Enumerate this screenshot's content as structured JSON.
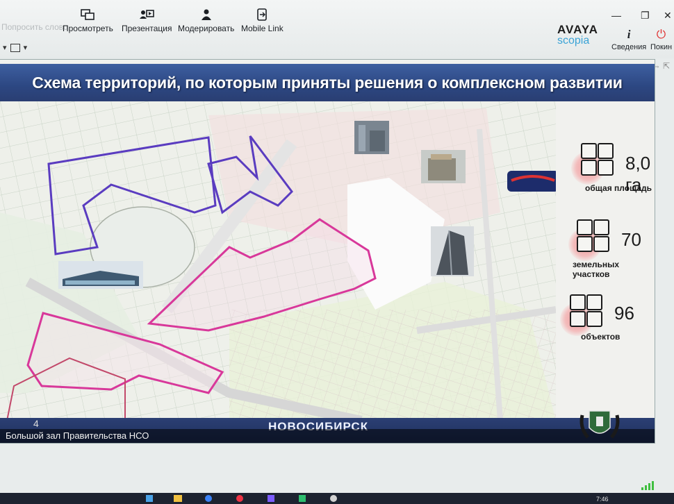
{
  "toolbar": {
    "ghost_label": "Попросить слово",
    "items": [
      {
        "label": "Просмотреть",
        "icon": "view-icon"
      },
      {
        "label": "Презентация",
        "icon": "presentation-icon"
      },
      {
        "label": "Модерировать",
        "icon": "moderate-icon"
      },
      {
        "label": "Mobile Link",
        "icon": "mobile-link-icon"
      }
    ],
    "brand_line1": "AVAYA",
    "brand_line2": "scopia",
    "info_label": "Сведения",
    "leave_label": "Покин"
  },
  "slide": {
    "title": "Схема территорий, по которым приняты решения о комплексном развитии",
    "stats": [
      {
        "value": "8,0 га",
        "label": "общая площадь"
      },
      {
        "value": "70",
        "label": "земельных участков"
      },
      {
        "value": "96",
        "label": "объектов"
      }
    ],
    "city": "НОВОСИБИРСК",
    "slide_number": "4",
    "room_label": "Большой зал Правительства НСО"
  },
  "taskbar": {
    "time": "7:46"
  },
  "colors": {
    "title_band": "#2c4782",
    "purple_border": "#5a3cc0",
    "magenta_border": "#d8389a",
    "scopia_blue": "#3aa3d6"
  }
}
